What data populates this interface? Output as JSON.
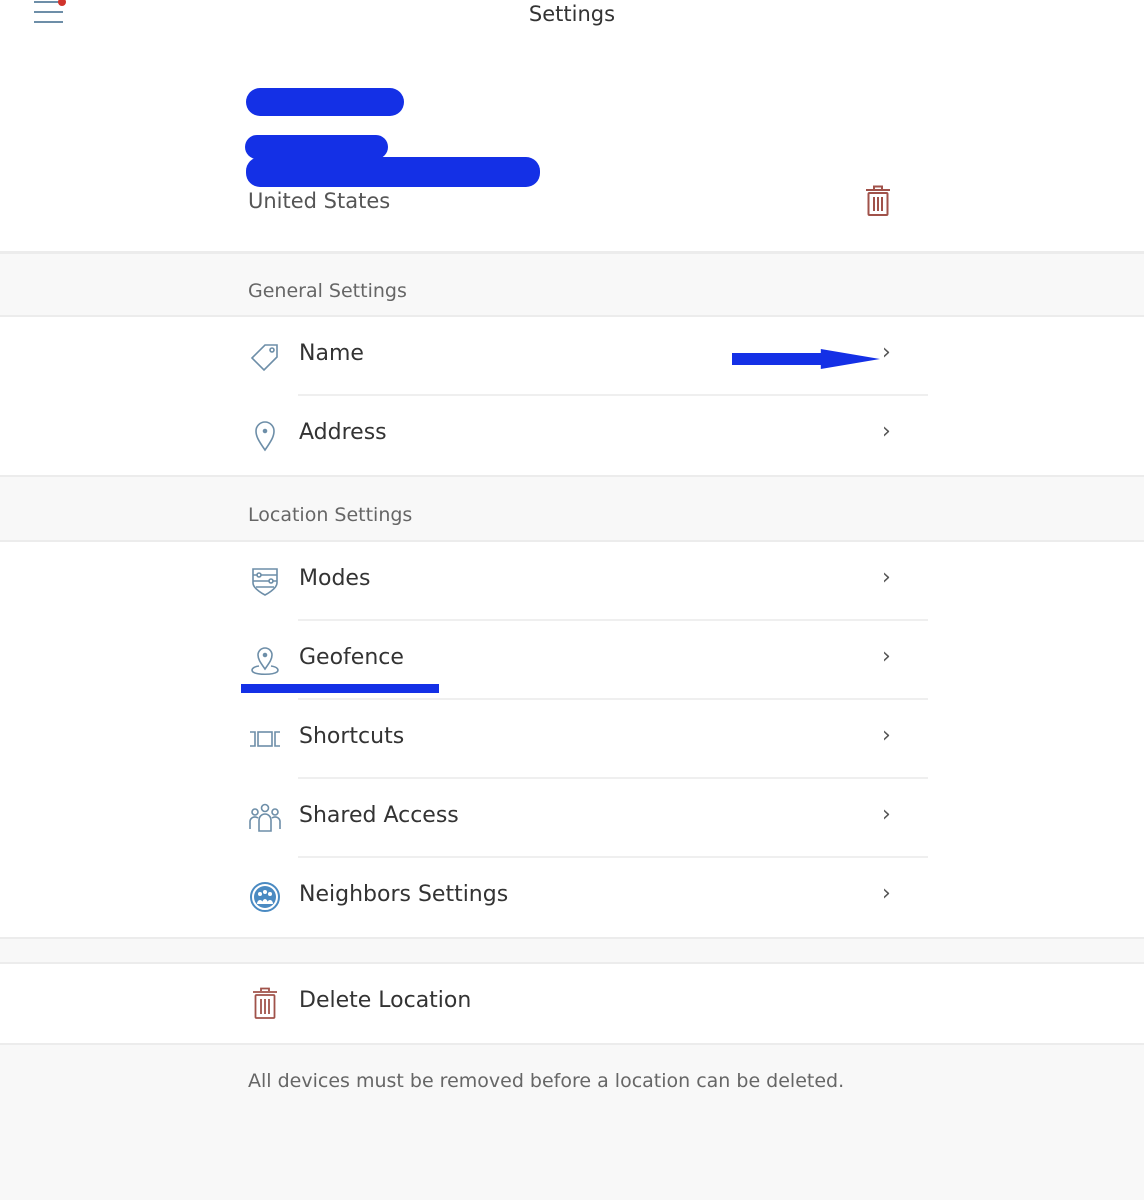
{
  "topbar": {
    "title": "Settings",
    "menu_icon": "hamburger-menu-icon",
    "notification_dot_color": "#d0342c"
  },
  "header": {
    "country": "United States",
    "trash_icon": "trash-icon",
    "redaction_color": "#1430e6"
  },
  "general_settings": {
    "label": "General Settings",
    "items": [
      {
        "label": "Name",
        "icon": "tag-icon",
        "value": ""
      },
      {
        "label": "Address",
        "icon": "map-pin-icon"
      }
    ]
  },
  "location_settings": {
    "label": "Location Settings",
    "items": [
      {
        "label": "Modes",
        "icon": "shield-modes-icon"
      },
      {
        "label": "Geofence",
        "icon": "geofence-icon"
      },
      {
        "label": "Shortcuts",
        "icon": "shortcuts-icon"
      },
      {
        "label": "Shared Access",
        "icon": "users-icon"
      },
      {
        "label": "Neighbors Settings",
        "icon": "neighbors-icon"
      }
    ]
  },
  "delete": {
    "label": "Delete Location",
    "icon": "trash-icon",
    "footnote": "All devices must be removed before a location can be deleted."
  },
  "chevron": "›"
}
